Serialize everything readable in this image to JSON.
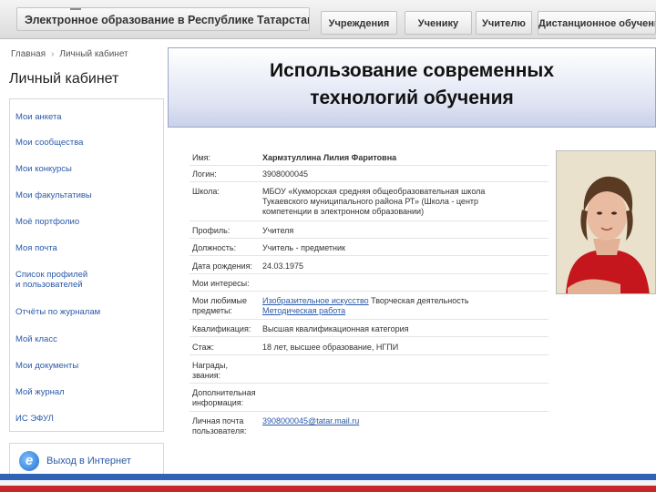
{
  "header": {
    "site_title": "Электронное образование в Республике Татарстан",
    "tabs": [
      {
        "label": "Учреждения"
      },
      {
        "label": "Ученику"
      },
      {
        "label": "Учителю"
      },
      {
        "label": "Дистанционное обучение"
      }
    ]
  },
  "breadcrumb": {
    "home": "Главная",
    "current": "Личный кабинет"
  },
  "page_title": "Личный кабинет",
  "slide_title": {
    "line1": "Использование современных",
    "line2": "технологий обучения"
  },
  "sidebar": {
    "items": [
      {
        "label": "Мои анкета"
      },
      {
        "label": "Мои сообщества"
      },
      {
        "label": "Мои конкурсы"
      },
      {
        "label": "Мои факультативы"
      },
      {
        "label": "Моё портфолио"
      },
      {
        "label": "Моя почта"
      },
      {
        "label": "Список профилей\nи пользователей"
      },
      {
        "label": "Отчёты по журналам"
      },
      {
        "label": "Мой класс"
      },
      {
        "label": "Мои документы"
      },
      {
        "label": "Мой журнал"
      },
      {
        "label": "ИС ЭФУЛ"
      }
    ],
    "internet_link": "Выход в Интернет",
    "internet_icon": "internet-explorer-icon"
  },
  "profile": {
    "fields": [
      {
        "label": "Имя:",
        "value": "Хармзтуллина Лилия Фаритовна"
      },
      {
        "label": "Логин:",
        "value": "3908000045"
      },
      {
        "label": "Школа:",
        "value": "МБОУ «Кукморская средняя общеобразовательная школа Тукаевского муниципального района РТ» (Школа - центр компетенции в электронном образовании)"
      },
      {
        "label": "Профиль:",
        "value": "Учителя"
      },
      {
        "label": "Должность:",
        "value": "Учитель - предметник"
      },
      {
        "label": "Дата рождения:",
        "value": "24.03.1975"
      },
      {
        "label": "Мои интересы:",
        "value": ""
      },
      {
        "label": "Мои любимые предметы:",
        "value_link": "Изобразительное искусство",
        "value_rest": " Творческая деятельность",
        "value_line2": "Методическая работа"
      },
      {
        "label": "Квалификация:",
        "value": "Высшая квалификационная категория"
      },
      {
        "label": "Стаж:",
        "value": "18 лет, высшее образование, НГПИ"
      },
      {
        "label": "Награды, звания:",
        "value": ""
      },
      {
        "label": "Дополнительная информация:",
        "value": ""
      },
      {
        "label": "Личная почта пользователя:",
        "value": "3908000045@tatar.mail.ru"
      }
    ]
  },
  "colors": {
    "link": "#2a5aa8",
    "accent_blue": "#2f63b5",
    "accent_red": "#c9262b",
    "banner": "#dfe4f3"
  }
}
